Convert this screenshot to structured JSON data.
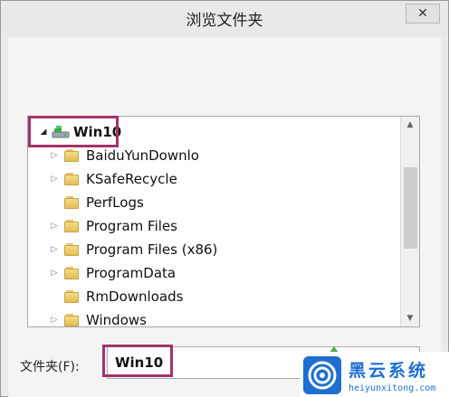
{
  "window": {
    "title": "浏览文件夹",
    "close_glyph": "✕"
  },
  "tree": {
    "root": {
      "label": "Win10",
      "expanded": true
    },
    "items": [
      {
        "label": "BaiduYunDownlo",
        "has_children": true
      },
      {
        "label": "KSafeRecycle",
        "has_children": true
      },
      {
        "label": "PerfLogs",
        "has_children": false
      },
      {
        "label": "Program Files",
        "has_children": true
      },
      {
        "label": "Program Files (x86)",
        "has_children": true
      },
      {
        "label": "ProgramData",
        "has_children": true
      },
      {
        "label": "RmDownloads",
        "has_children": false
      },
      {
        "label": "Windows",
        "has_children": true
      }
    ],
    "expander_collapsed": "▷",
    "expander_expanded": "◢",
    "scroll_up_glyph": "▲",
    "scroll_down_glyph": "▼"
  },
  "folder_field": {
    "label": "文件夹(F):",
    "value": "Win10"
  },
  "watermark": {
    "text": "黑云系统",
    "url": "heiyunxitong.com"
  },
  "colors": {
    "highlight_box": "#a0346a",
    "folder": "#e2bd55",
    "watermark": "#1e6fd0"
  }
}
